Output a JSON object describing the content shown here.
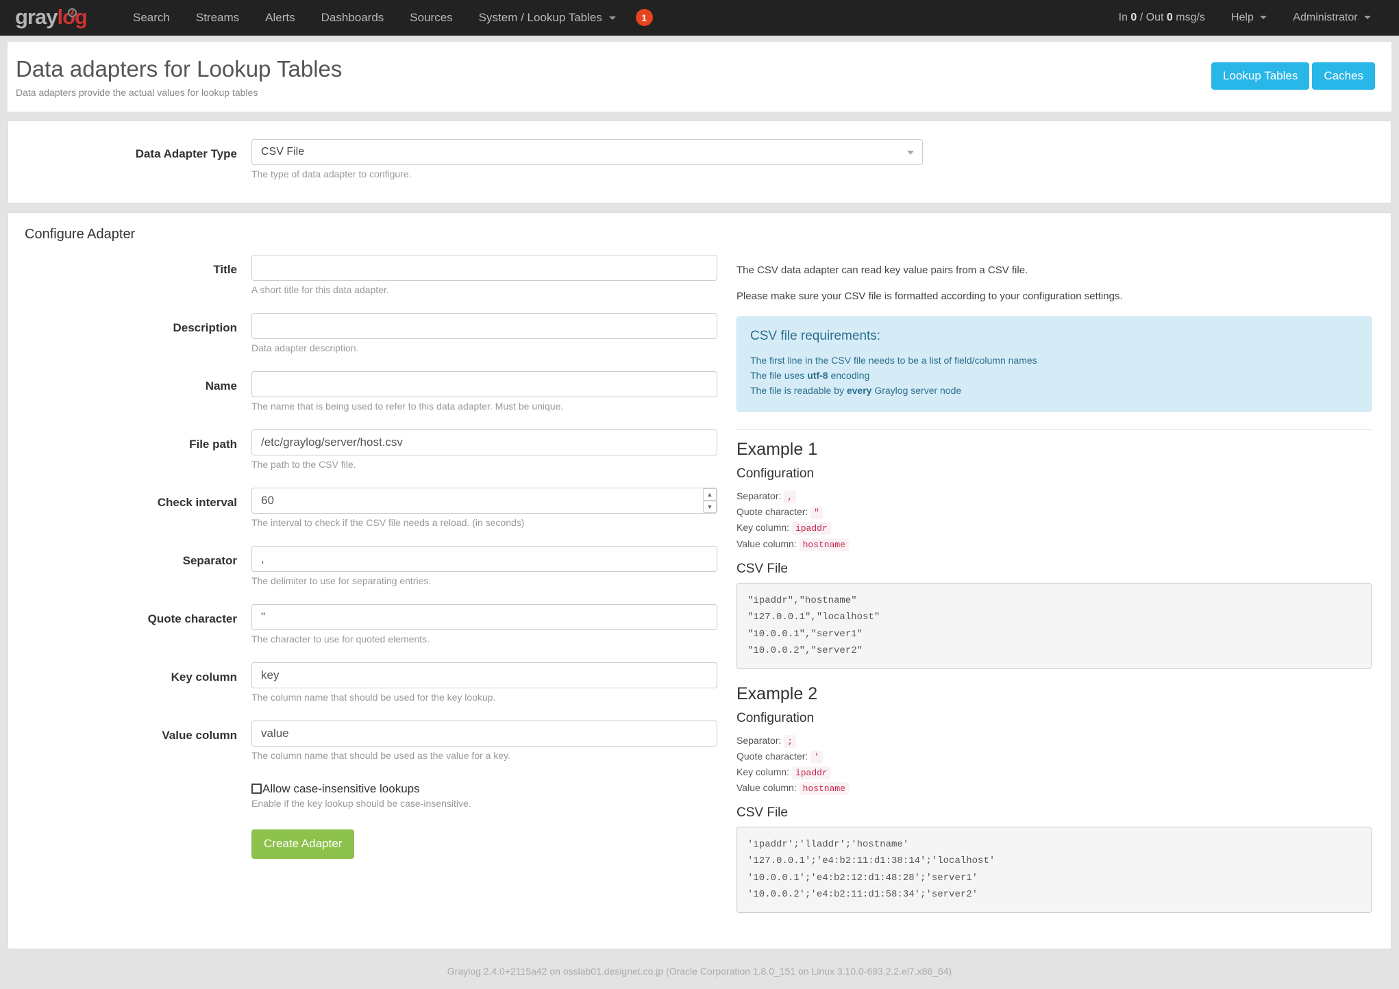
{
  "navbar": {
    "brand": {
      "part1": "gray",
      "part2": "log"
    },
    "links": [
      {
        "label": "Search",
        "caret": false
      },
      {
        "label": "Streams",
        "caret": false
      },
      {
        "label": "Alerts",
        "caret": false
      },
      {
        "label": "Dashboards",
        "caret": false
      },
      {
        "label": "Sources",
        "caret": false
      },
      {
        "label": "System / Lookup Tables",
        "caret": true
      }
    ],
    "badge": "1",
    "throughput": {
      "prefix": "In ",
      "in": "0",
      "middle": " / Out ",
      "out": "0",
      "suffix": " msg/s"
    },
    "help_label": "Help",
    "user_label": "Administrator"
  },
  "header": {
    "title": "Data adapters for Lookup Tables",
    "subtitle": "Data adapters provide the actual values for lookup tables",
    "lookup_tables_button": "Lookup Tables",
    "caches_button": "Caches"
  },
  "type_panel": {
    "label": "Data Adapter Type",
    "selected": "CSV File",
    "help": "The type of data adapter to configure."
  },
  "configure": {
    "title": "Configure Adapter",
    "fields": [
      {
        "label": "Title",
        "value": "",
        "placeholder": "",
        "help": "A short title for this data adapter."
      },
      {
        "label": "Description",
        "value": "",
        "placeholder": "",
        "help": "Data adapter description."
      },
      {
        "label": "Name",
        "value": "",
        "placeholder": "",
        "help": "The name that is being used to refer to this data adapter. Must be unique."
      },
      {
        "label": "File path",
        "value": "/etc/graylog/server/host.csv",
        "placeholder": "",
        "help": "The path to the CSV file."
      },
      {
        "label": "Check interval",
        "value": "60",
        "placeholder": "",
        "help": "The interval to check if the CSV file needs a reload. (in seconds)"
      },
      {
        "label": "Separator",
        "value": ",",
        "placeholder": "",
        "help": "The delimiter to use for separating entries."
      },
      {
        "label": "Quote character",
        "value": "\"",
        "placeholder": "",
        "help": "The character to use for quoted elements."
      },
      {
        "label": "Key column",
        "value": "key",
        "placeholder": "",
        "help": "The column name that should be used for the key lookup."
      },
      {
        "label": "Value column",
        "value": "value",
        "placeholder": "",
        "help": "The column name that should be used as the value for a key."
      }
    ],
    "checkbox": {
      "label": "Allow case-insensitive lookups",
      "checked": false,
      "help": "Enable if the key lookup should be case-insensitive."
    },
    "submit_label": "Create Adapter"
  },
  "doc": {
    "intro1": "The CSV data adapter can read key value pairs from a CSV file.",
    "intro2": "Please make sure your CSV file is formatted according to your configuration settings.",
    "alert": {
      "title": "CSV file requirements:",
      "line1": "The first line in the CSV file needs to be a list of field/column names",
      "line2_pre": "The file uses ",
      "line2_strong": "utf-8",
      "line2_post": " encoding",
      "line3_pre": "The file is readable by ",
      "line3_strong": "every",
      "line3_post": " Graylog server node"
    },
    "examples": [
      {
        "title": "Example 1",
        "config_label": "Configuration",
        "separator_label": "Separator:",
        "separator_value": ",",
        "quote_label": "Quote character:",
        "quote_value": "\"",
        "key_label": "Key column:",
        "key_value": "ipaddr",
        "value_label": "Value column:",
        "value_value": "hostname",
        "csv_label": "CSV File",
        "csv_content": "\"ipaddr\",\"hostname\"\n\"127.0.0.1\",\"localhost\"\n\"10.0.0.1\",\"server1\"\n\"10.0.0.2\",\"server2\""
      },
      {
        "title": "Example 2",
        "config_label": "Configuration",
        "separator_label": "Separator:",
        "separator_value": ";",
        "quote_label": "Quote character:",
        "quote_value": "'",
        "key_label": "Key column:",
        "key_value": "ipaddr",
        "value_label": "Value column:",
        "value_value": "hostname",
        "csv_label": "CSV File",
        "csv_content": "'ipaddr';'lladdr';'hostname'\n'127.0.0.1';'e4:b2:11:d1:38:14';'localhost'\n'10.0.0.1';'e4:b2:12:d1:48:28';'server1'\n'10.0.0.2';'e4:b2:11:d1:58:34';'server2'"
      }
    ]
  },
  "footer": {
    "text": "Graylog 2.4.0+2115a42 on osslab01.designet.co.jp (Oracle Corporation 1.8.0_151 on Linux 3.10.0-693.2.2.el7.x86_64)"
  }
}
